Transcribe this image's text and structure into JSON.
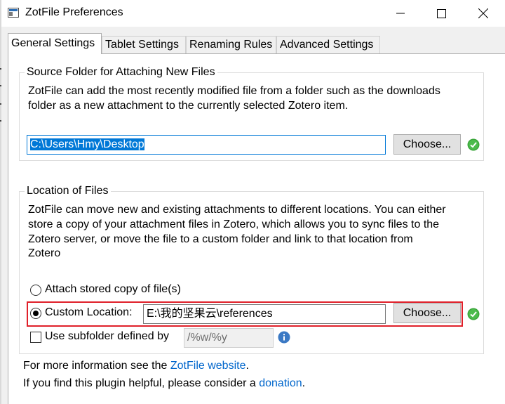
{
  "window": {
    "title": "ZotFile Preferences"
  },
  "tabs": [
    {
      "label": "General Settings",
      "active": true
    },
    {
      "label": "Tablet Settings",
      "active": false
    },
    {
      "label": "Renaming Rules",
      "active": false
    },
    {
      "label": "Advanced Settings",
      "active": false
    }
  ],
  "source_folder": {
    "legend": "Source Folder for Attaching New Files",
    "description_line1": "ZotFile can add the most recently modified file from a folder such as the downloads",
    "description_line2": "folder as a new attachment to the currently selected Zotero item.",
    "path_value": "C:\\Users\\Hmy\\Desktop",
    "choose_label": "Choose..."
  },
  "location": {
    "legend": "Location of Files",
    "description_line1": "ZotFile can move new and existing attachments to different locations. You can either",
    "description_line2": "store a copy of your attachment files in Zotero, which allows you to sync files to the",
    "description_line3": "Zotero server, or move the file to a custom folder and link to that location from",
    "description_line4": "Zotero",
    "option_stored": "Attach stored copy of file(s)",
    "option_custom": "Custom Location:",
    "custom_path": "E:\\我的坚果云\\references",
    "choose_label": "Choose...",
    "subfolder_label": "Use subfolder defined by",
    "subfolder_value": "/%w/%y",
    "selected_option": "custom",
    "subfolder_checked": false
  },
  "footer": {
    "info_prefix": "For more information see the ",
    "info_link": "ZotFile website",
    "info_suffix": ".",
    "help_prefix": "If you find this plugin helpful, please consider a ",
    "help_link": "donation",
    "help_suffix": "."
  },
  "colors": {
    "accent": "#0078d7",
    "highlight_border": "#e0202a",
    "link": "#0066cc",
    "ok_green": "#3aa53a"
  },
  "icons": [
    "app-icon",
    "minimize-icon",
    "maximize-icon",
    "close-icon",
    "ok-check-icon",
    "info-icon"
  ]
}
